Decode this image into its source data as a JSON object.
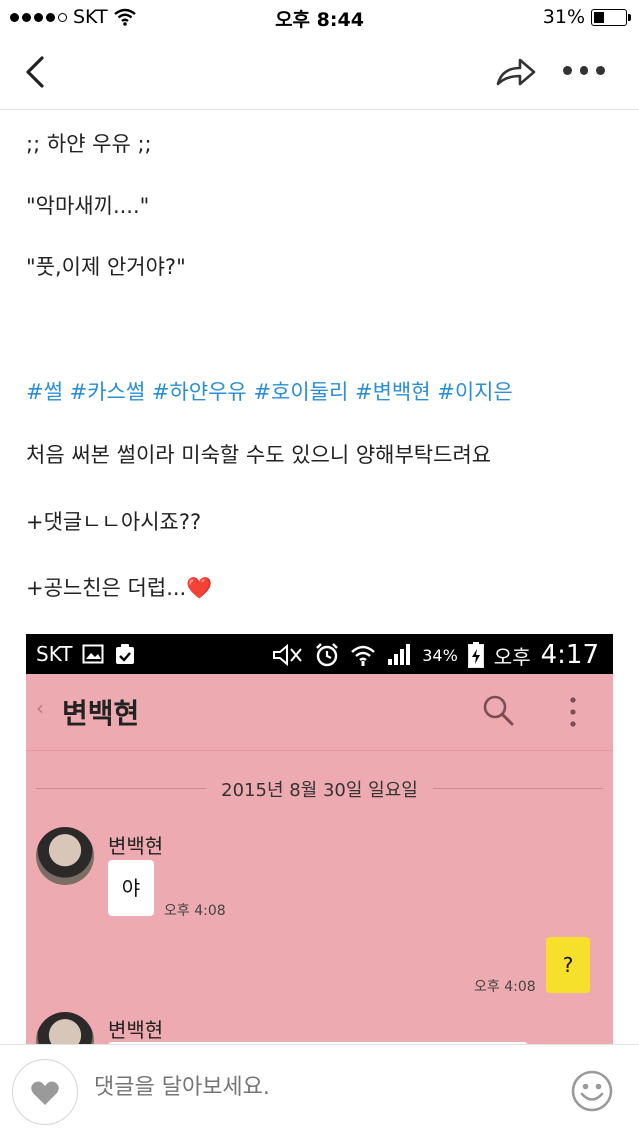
{
  "status_bar": {
    "carrier": "SKT",
    "time": "오후 8:44",
    "battery": "31%"
  },
  "post": {
    "lines": [
      ";; 하얀 우유 ;;",
      "\"악마새끼....\"",
      "\"풋,이제 안거야?\""
    ],
    "hashtags": [
      "#썰",
      "#카스썰",
      "#하얀우유",
      "#호이둘리",
      "#변백현",
      "#이지은"
    ],
    "notes": [
      "처음 써본 썰이라 미숙할 수도 있으니 양해부탁드려요",
      "+댓글ㄴㄴ아시죠??",
      "+공느친은 더럽..."
    ],
    "heart_emoji": "❤️"
  },
  "embedded_screenshot": {
    "status_bar": {
      "carrier": "SKT",
      "battery": "34%",
      "time_prefix": "오후",
      "time": "4:17"
    },
    "chat_title": "변백현",
    "date_separator": "2015년 8월 30일 일요일",
    "messages": [
      {
        "sender": "변백현",
        "text": "야",
        "time": "오후 4:08"
      },
      {
        "sender": "me",
        "text": "?",
        "time": "오후 4:08"
      },
      {
        "sender": "변백현",
        "text": "",
        "time": ""
      }
    ]
  },
  "comment_bar": {
    "placeholder": "댓글을 달아보세요."
  },
  "colors": {
    "hashtag": "#2a8fd6",
    "chat_background": "#eeaab1",
    "my_bubble": "#f7e02b"
  }
}
